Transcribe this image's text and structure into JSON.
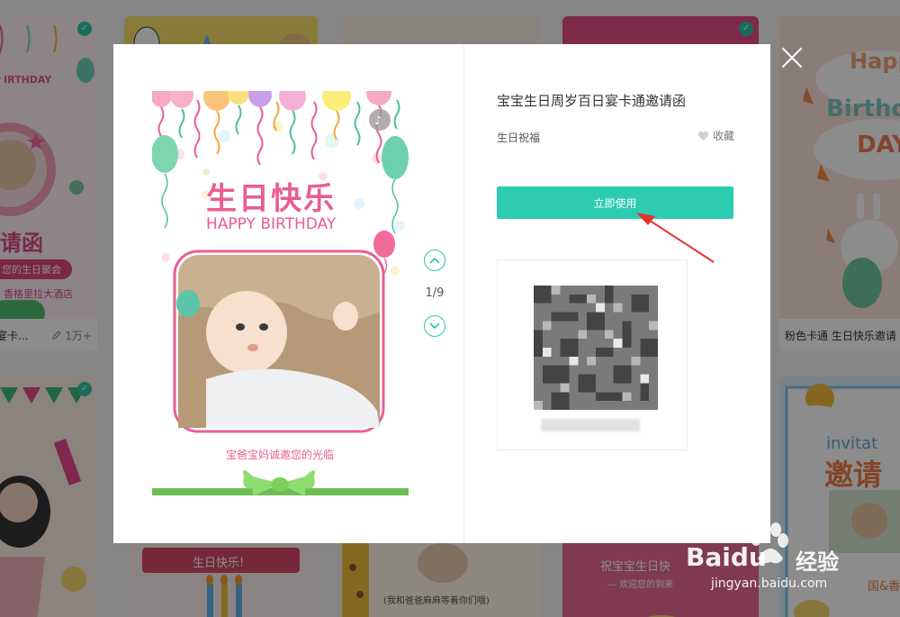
{
  "background": {
    "left_card_caption": "宴卡...",
    "left_card_views": "1万+",
    "left_card_title": "请函",
    "left_card_ribbon": "您的生日聚会",
    "left_card_address": "香格里拉大酒店",
    "right_card_caption": "粉色卡通 生日快乐邀请",
    "right_card_text1": "Happ",
    "right_card_text2": "Birthd",
    "right_card_text3": "DAY",
    "bottom_card1_banner": "生日快乐!",
    "bottom_card2_text": "(我和爸爸麻麻等着你们哦)",
    "bottom_card3_text1": "祝宝宝生日快",
    "bottom_card3_text2": "— 欢迎您的到来",
    "right_card2_text1": "invitat",
    "right_card2_text2": "邀请",
    "right_card2_text3": "国&香"
  },
  "modal": {
    "title": "宝宝生日周岁百日宴卡通邀请函",
    "category": "生日祝福",
    "favorite_label": "收藏",
    "use_button_label": "立即使用",
    "page_indicator": "1/9",
    "preview": {
      "title_cn": "生日快乐",
      "title_en": "HAPPY BIRTHDAY",
      "invite_text": "宝爸宝妈诚邀您的光临"
    }
  },
  "watermark": {
    "brand": "Baidu",
    "brand_cn": "经验",
    "url": "jingyan.baidu.com"
  },
  "colors": {
    "accent": "#2dccb0",
    "pink": "#f06aa0",
    "overlay": "rgba(0,0,0,0.45)",
    "annotation_arrow": "#e8322e"
  },
  "icons": [
    "close-icon",
    "heart-icon",
    "chevron-up-icon",
    "chevron-down-icon",
    "music-icon",
    "eye-icon"
  ]
}
